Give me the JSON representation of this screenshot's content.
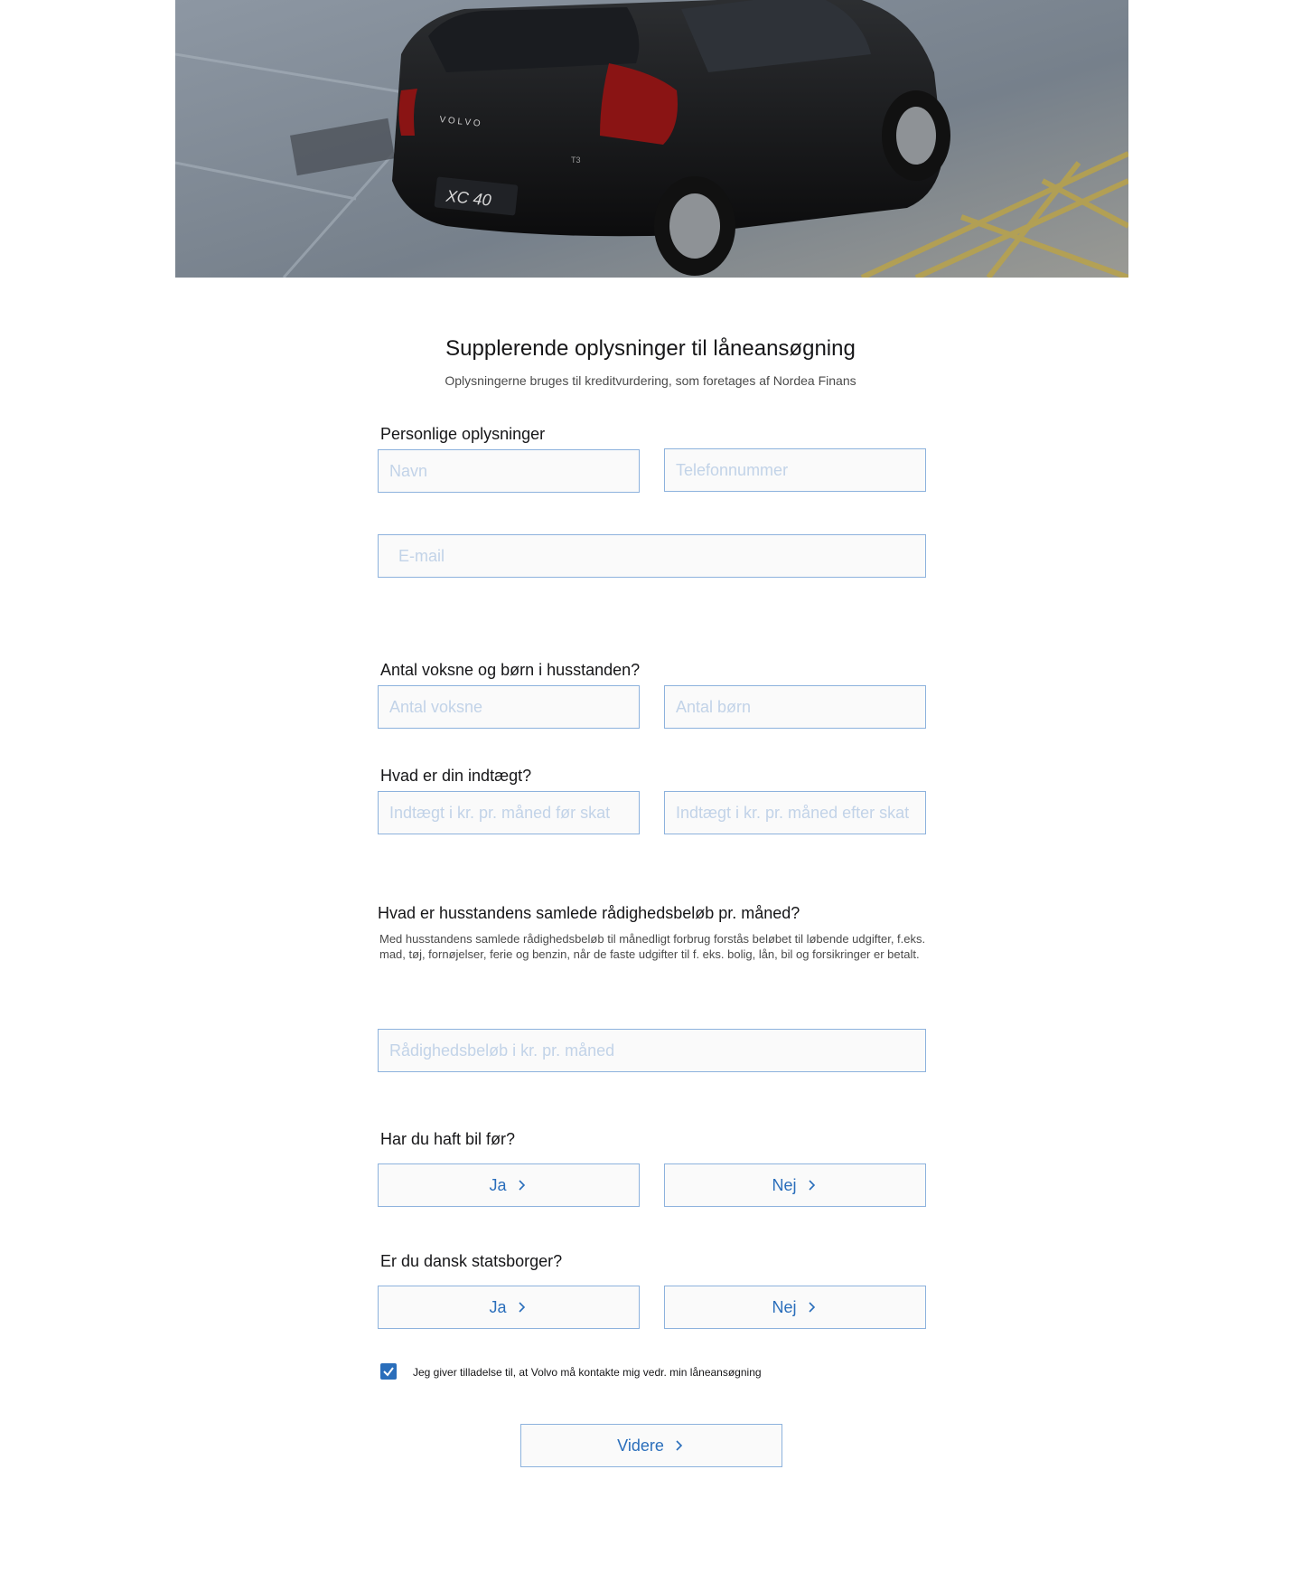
{
  "hero": {
    "badge_text": "XC 40",
    "brand_lettering": "V O L V O",
    "trim_text": "T3"
  },
  "header": {
    "title": "Supplerende oplysninger til låneansøgning",
    "subtitle": "Oplysningerne bruges til kreditvurdering, som foretages af Nordea Finans"
  },
  "personal": {
    "label": "Personlige oplysninger",
    "name_placeholder": "Navn",
    "phone_placeholder": "Telefonnummer",
    "email_placeholder": "E-mail"
  },
  "household": {
    "label": "Antal voksne og børn i husstanden?",
    "adults_placeholder": "Antal voksne",
    "children_placeholder": "Antal børn"
  },
  "income": {
    "label": "Hvad er din indtægt?",
    "before_tax_placeholder": "Indtægt i kr. pr. måned før skat",
    "after_tax_placeholder": "Indtægt i kr. pr. måned efter skat"
  },
  "disposable": {
    "label": "Hvad er husstandens samlede rådighedsbeløb pr. måned?",
    "description": "Med husstandens samlede rådighedsbeløb til månedligt forbrug forstås beløbet til løbende udgifter, f.eks. mad, tøj, fornøjelser, ferie og benzin, når de faste udgifter til f. eks. bolig, lån, bil og forsikringer er betalt.",
    "amount_placeholder": "Rådighedsbeløb i kr. pr. måned"
  },
  "previous_car": {
    "label": "Har du haft bil før?",
    "yes_label": "Ja",
    "no_label": "Nej"
  },
  "citizen": {
    "label": "Er du dansk statsborger?",
    "yes_label": "Ja",
    "no_label": "Nej"
  },
  "consent": {
    "checked": true,
    "label": "Jeg giver tilladelse til, at Volvo må kontakte mig vedr. min låneansøgning"
  },
  "submit": {
    "label": "Videre"
  },
  "colors": {
    "accent": "#2a6ebb",
    "field_border": "#8db2dd",
    "field_bg": "#fafafa"
  }
}
